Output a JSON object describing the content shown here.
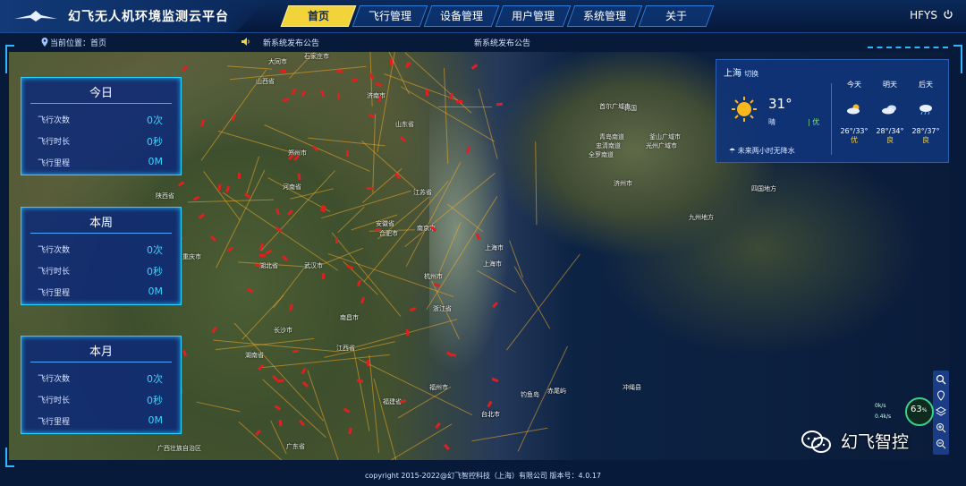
{
  "header": {
    "app_title": "幻飞无人机环境监测云平台",
    "nav": [
      {
        "label": "首页",
        "active": true
      },
      {
        "label": "飞行管理",
        "active": false
      },
      {
        "label": "设备管理",
        "active": false
      },
      {
        "label": "用户管理",
        "active": false
      },
      {
        "label": "系统管理",
        "active": false
      },
      {
        "label": "关于",
        "active": false
      }
    ],
    "user": "HFYS"
  },
  "infobar": {
    "location": "当前位置：首页",
    "notice_left": "新系统发布公告",
    "notice_center": "新系统发布公告"
  },
  "stats": [
    {
      "title": "今日",
      "rows": [
        {
          "label": "飞行次数",
          "value": "0次"
        },
        {
          "label": "飞行时长",
          "value": "0秒"
        },
        {
          "label": "飞行里程",
          "value": "0M"
        }
      ]
    },
    {
      "title": "本周",
      "rows": [
        {
          "label": "飞行次数",
          "value": "0次"
        },
        {
          "label": "飞行时长",
          "value": "0秒"
        },
        {
          "label": "飞行里程",
          "value": "0M"
        }
      ]
    },
    {
      "title": "本月",
      "rows": [
        {
          "label": "飞行次数",
          "value": "0次"
        },
        {
          "label": "飞行时长",
          "value": "0秒"
        },
        {
          "label": "飞行里程",
          "value": "0M"
        }
      ]
    }
  ],
  "weather": {
    "city": "上海",
    "switch_label": "切换",
    "temp": "31°",
    "condition": "晴",
    "aqi": "优",
    "rain_note": "未来两小时无降水",
    "forecast": [
      {
        "day": "今天",
        "range": "26°/33°",
        "quality": "优",
        "icon": "partly-cloudy-icon"
      },
      {
        "day": "明天",
        "range": "28°/34°",
        "quality": "良",
        "icon": "cloudy-icon"
      },
      {
        "day": "后天",
        "range": "28°/37°",
        "quality": "良",
        "icon": "rain-cloud-icon"
      }
    ]
  },
  "map": {
    "places": [
      "大同市",
      "石家庄市",
      "山西省",
      "济南市",
      "山东省",
      "郑州市",
      "河南省",
      "陕西省",
      "江苏省",
      "安徽省",
      "合肥市",
      "南京市",
      "上海市",
      "上海市",
      "湖北省",
      "重庆市",
      "武汉市",
      "杭州市",
      "浙江省",
      "长沙市",
      "南昌市",
      "江西省",
      "湖南省",
      "福州市",
      "福建省",
      "台北市",
      "广东省",
      "广西壮族自治区",
      "韩国",
      "首尔广域市",
      "忠清南道",
      "全罗南道",
      "济州市",
      "釜山广域市",
      "光州广域市",
      "青岛南道",
      "四国地方",
      "九州地方",
      "赤尾屿",
      "钓鱼岛",
      "冲绳县",
      "台北市"
    ],
    "speed_up": "0k/s",
    "speed_down": "0.4k/s",
    "gauge_value": "63",
    "gauge_unit": "%"
  },
  "watermark": "幻飞智控",
  "footer": "copyright 2015-2022@幻飞智控科技（上海）有限公司 版本号：4.0.17"
}
